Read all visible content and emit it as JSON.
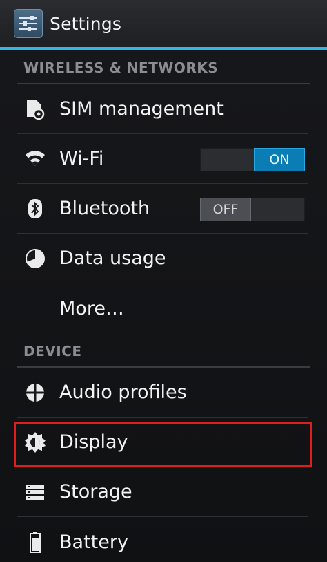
{
  "actionbar": {
    "title": "Settings",
    "icon": "settings-sliders-icon"
  },
  "sections": {
    "wireless": {
      "header": "WIRELESS & NETWORKS",
      "items": [
        {
          "label": "SIM management",
          "icon": "sim-card-icon"
        },
        {
          "label": "Wi-Fi",
          "icon": "wifi-icon",
          "toggle": "ON"
        },
        {
          "label": "Bluetooth",
          "icon": "bluetooth-icon",
          "toggle": "OFF"
        },
        {
          "label": "Data usage",
          "icon": "data-usage-icon"
        },
        {
          "label": "More…",
          "icon": ""
        }
      ]
    },
    "device": {
      "header": "DEVICE",
      "items": [
        {
          "label": "Audio profiles",
          "icon": "audio-profiles-icon"
        },
        {
          "label": "Display",
          "icon": "display-brightness-icon"
        },
        {
          "label": "Storage",
          "icon": "storage-icon"
        },
        {
          "label": "Battery",
          "icon": "battery-icon"
        }
      ]
    }
  },
  "colors": {
    "accent": "#33b5e5",
    "toggle_on": "#0a7db4",
    "highlight": "#e01e1e"
  }
}
